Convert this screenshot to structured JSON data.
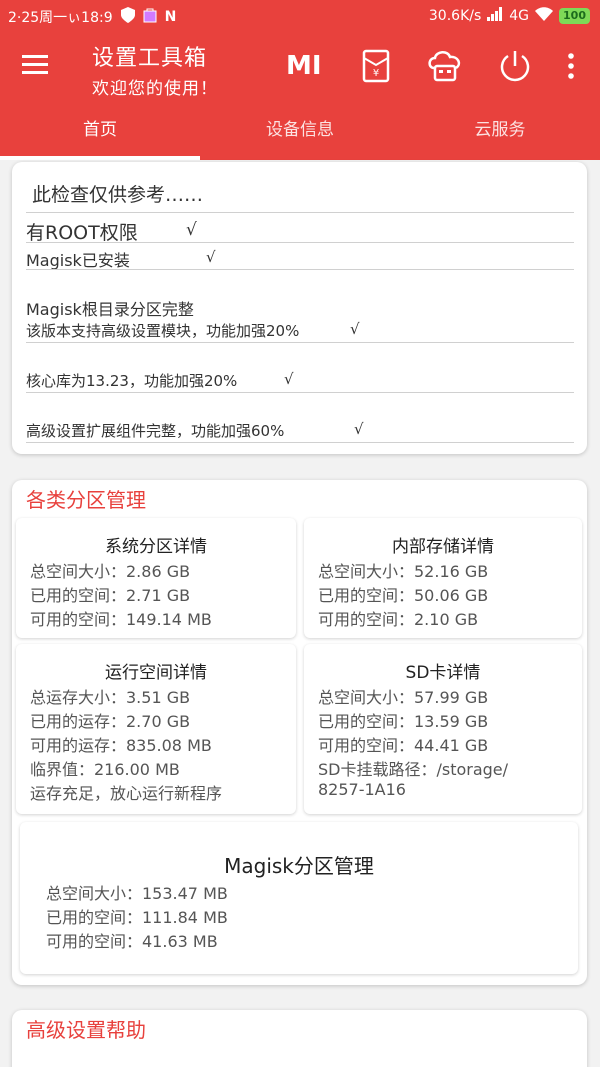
{
  "statusbar": {
    "time": "2·25周一ぃ18:9",
    "speed": "30.6K/s",
    "network": "4G",
    "battery": "100"
  },
  "appbar": {
    "title": "设置工具箱",
    "subtitle": "欢迎您的使用！",
    "mi_label": "MI"
  },
  "tabs": [
    {
      "label": "首页"
    },
    {
      "label": "设备信息"
    },
    {
      "label": "云服务"
    }
  ],
  "check": {
    "title": "此检查仅供参考……",
    "items": [
      "有ROOT权限",
      "Magisk已安装",
      "Magisk根目录分区完整",
      "该版本支持高级设置模块，功能加强20%",
      "核心库为13.23，功能加强20%",
      "高级设置扩展组件完整，功能加强60%"
    ],
    "mark": "√"
  },
  "partitions": {
    "title": "各类分区管理",
    "system": {
      "title": "系统分区详情",
      "lines": [
        "总空间大小：2.86 GB",
        "已用的空间：2.71 GB",
        "可用的空间：149.14 MB"
      ]
    },
    "internal": {
      "title": "内部存储详情",
      "lines": [
        "总空间大小：52.16 GB",
        "已用的空间：50.06 GB",
        "可用的空间：2.10 GB"
      ]
    },
    "ram": {
      "title": "运行空间详情",
      "lines": [
        "总运存大小：3.51 GB",
        "已用的运存：2.70 GB",
        "可用的运存：835.08 MB",
        " 临界值：216.00 MB",
        "运存充足，放心运行新程序"
      ]
    },
    "sd": {
      "title": "SD卡详情",
      "lines": [
        "总空间大小：57.99 GB",
        "已用的空间：13.59 GB",
        "可用的空间：44.41 GB",
        "SD卡挂载路径：/storage/",
        "8257-1A16"
      ]
    },
    "magisk": {
      "title": "Magisk分区管理",
      "lines": [
        "总空间大小：153.47 MB",
        "已用的空间：111.84 MB",
        "可用的空间：41.63 MB"
      ]
    }
  },
  "help": {
    "title": "高级设置帮助"
  }
}
